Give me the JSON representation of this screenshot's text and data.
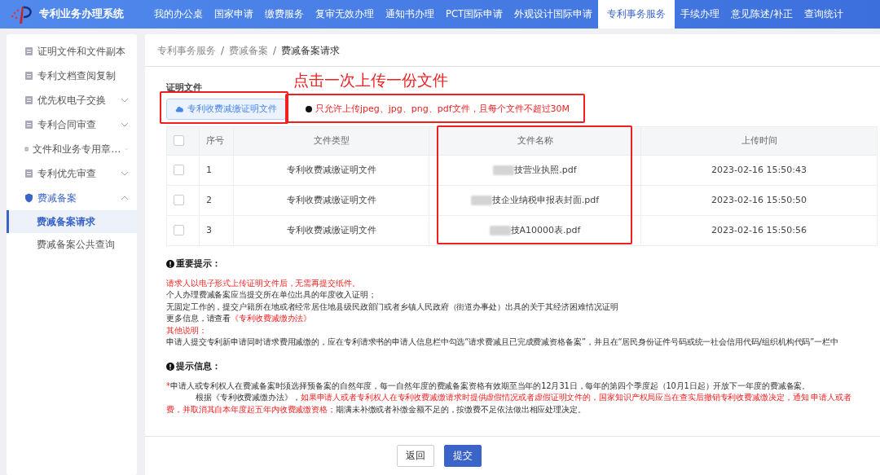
{
  "app": {
    "title": "专利业务办理系统"
  },
  "nav": [
    {
      "label": "我的办公桌",
      "selected": false
    },
    {
      "label": "国家申请",
      "selected": false
    },
    {
      "label": "缴费服务",
      "selected": false
    },
    {
      "label": "复审无效办理",
      "selected": false
    },
    {
      "label": "通知书办理",
      "selected": false
    },
    {
      "label": "PCT国际申请",
      "selected": false
    },
    {
      "label": "外观设计国际申请",
      "selected": false
    },
    {
      "label": "专利事务服务",
      "selected": true
    },
    {
      "label": "手续办理",
      "selected": false
    },
    {
      "label": "意见陈述/补正",
      "selected": false
    },
    {
      "label": "查询统计",
      "selected": false
    }
  ],
  "sidebar": {
    "items": [
      {
        "label": "证明文件和文件副本",
        "kind": "link",
        "selected": false
      },
      {
        "label": "专利文档查阅复制",
        "kind": "link",
        "selected": false
      },
      {
        "label": "优先权电子交换",
        "kind": "group",
        "expanded": false,
        "selected": false
      },
      {
        "label": "专利合同审查",
        "kind": "group",
        "expanded": false,
        "selected": false
      },
      {
        "label": "文件和业务专用章…",
        "kind": "group",
        "expanded": false,
        "selected": false
      },
      {
        "label": "专利优先审查",
        "kind": "group",
        "expanded": false,
        "selected": false
      },
      {
        "label": "费减备案",
        "kind": "group",
        "expanded": true,
        "selected": true,
        "children": [
          {
            "label": "费减备案请求",
            "selected": true
          },
          {
            "label": "费减备案公共查询",
            "selected": false
          }
        ]
      }
    ]
  },
  "breadcrumb": [
    {
      "kind": "link",
      "text": "专利事务服务"
    },
    {
      "kind": "separator",
      "text": "/"
    },
    {
      "kind": "link",
      "text": "费减备案"
    },
    {
      "kind": "separator",
      "text": "/"
    },
    {
      "kind": "current",
      "text": "费减备案请求"
    }
  ],
  "upload": {
    "title": "证明文件",
    "button": "专利收费减缴证明文件",
    "hint": "只允许上传jpeg、jpg、png、pdf文件，且每个文件不超过30M"
  },
  "annotation": {
    "text": "点击一次上传一份文件"
  },
  "table": {
    "all_checked": false,
    "columns": [
      "序号",
      "文件类型",
      "文件名称",
      "上传时间"
    ],
    "rows": [
      {
        "checked": false,
        "cells": [
          "1",
          "专利收费减缴证明文件",
          "技营业执照.pdf",
          "2023-02-16 15:50:43"
        ]
      },
      {
        "checked": false,
        "cells": [
          "2",
          "专利收费减缴证明文件",
          "技企业纳税申报表封面.pdf",
          "2023-02-16 15:50:50"
        ]
      },
      {
        "checked": false,
        "cells": [
          "3",
          "专利收费减缴证明文件",
          "技A10000表.pdf",
          "2023-02-16 15:50:56"
        ]
      }
    ]
  },
  "notices": [
    {
      "title": "重要提示：",
      "lines": [
        [
          {
            "text": "请求人以电子形式上传证明文件后，无需再提交纸件。",
            "highlight": true
          }
        ],
        [
          {
            "text": "个人办理费减备案应当提交所在单位出具的年度收入证明；",
            "highlight": false
          }
        ],
        [
          {
            "text": "无固定工作的，提交户籍所在地或者经常居住地县级民政部门或者乡镇人民政府（街道办事处）出具的关于其经济困难情况证明",
            "highlight": false
          }
        ],
        [
          {
            "text": "更多信息，请查看",
            "highlight": false
          },
          {
            "text": "《专利收费减缴办法》",
            "highlight": true
          }
        ],
        [
          {
            "text": "其他说明：",
            "highlight": true
          }
        ],
        [
          {
            "text": "申请人提交专利新申请同时请求费用减缴的，应在专利请求书的申请人信息栏中勾选“请求费减且已完成费减资格备案”，并且在“居民身份证件号码或统一社会信用代码/组织机构代码”一栏中",
            "highlight": false
          }
        ]
      ]
    },
    {
      "title": "提示信息：",
      "lines": [
        [
          {
            "text": "*",
            "highlight": true
          },
          {
            "text": "申请人或专利权人在费减备案时须选择预备案的自然年度，每一自然年度的费减备案资格有效期至当年的12月31日，每年的第四个季度起（10月1日起）开放下一年度的费减备案。",
            "highlight": false
          }
        ],
        [
          {
            "text": "根据《专利收费减缴办法》，",
            "highlight": false,
            "indent": true
          },
          {
            "text": "如果申请人或者专利权人在专利收费减缴请求时提供虚假情况或者虚假证明文件的，国家知识产权局应当在查实后撤销专利收费减缴决定，通知 申请人或者",
            "highlight": true
          }
        ],
        [
          {
            "text": "费，并取消其自本年度起五年内收费减缴资格；",
            "highlight": true
          },
          {
            "text": "期满未补缴或者补缴金额不足的，按缴费不足依法做出相应处理决定。",
            "highlight": false
          }
        ]
      ]
    }
  ],
  "buttons": [
    {
      "label": "返回",
      "kind": "secondary"
    },
    {
      "label": "提交",
      "kind": "primary"
    }
  ]
}
